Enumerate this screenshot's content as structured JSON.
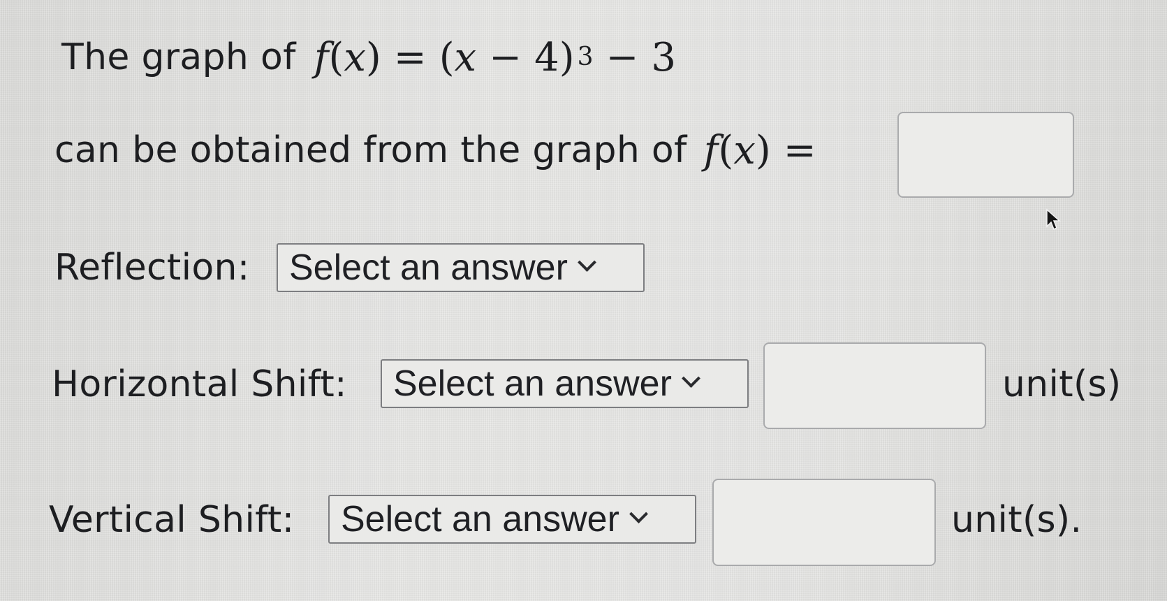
{
  "question": {
    "line1_text": "The graph of",
    "line1_formula": {
      "f": "f",
      "open": "(",
      "x": "x",
      "close": ")",
      "eq": "=",
      "paren_open": "(",
      "x2": "x",
      "minus": "−",
      "four": "4",
      "paren_close": ")",
      "exp": "3",
      "minus2": "−",
      "three": "3"
    },
    "line2_text": "can be obtained from the graph of",
    "line2_formula": {
      "f": "f",
      "open": "(",
      "x": "x",
      "close": ")",
      "eq": "="
    }
  },
  "reflection": {
    "label": "Reflection:",
    "select_value": "Select an answer"
  },
  "horizontal": {
    "label": "Horizontal Shift:",
    "select_value": "Select an answer",
    "unit": "unit(s)"
  },
  "vertical": {
    "label": "Vertical Shift:",
    "select_value": "Select an answer",
    "unit": "unit(s)."
  }
}
